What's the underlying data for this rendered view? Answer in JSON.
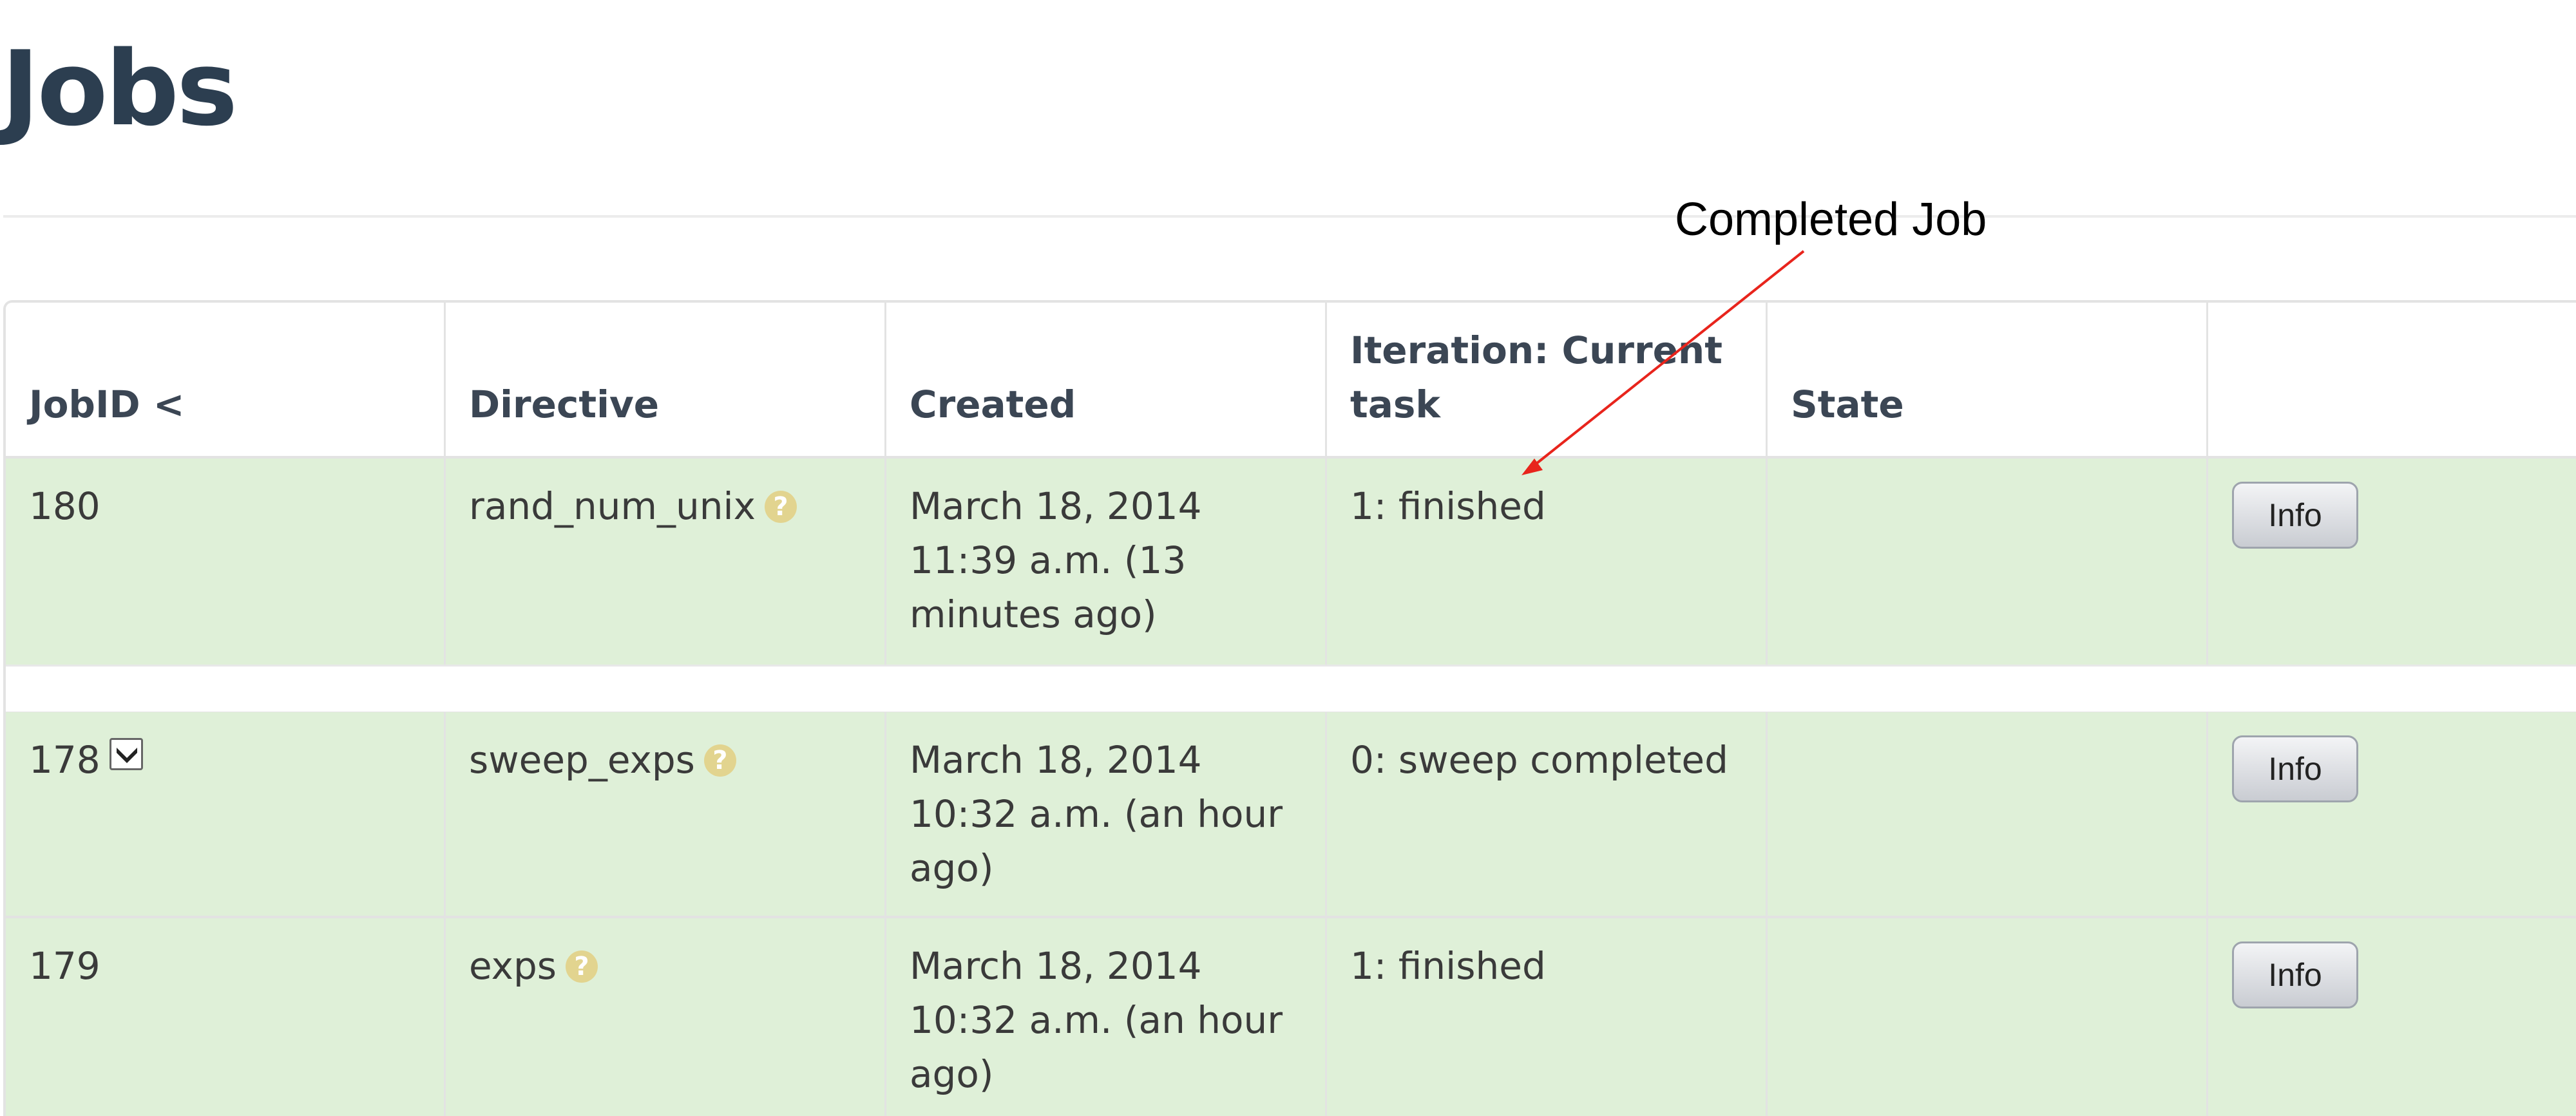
{
  "page": {
    "title": "Jobs"
  },
  "annotation": {
    "text": "Completed Job"
  },
  "table": {
    "headers": [
      "JobID <",
      "Directive",
      "Created",
      "Iteration: Current task",
      "State",
      ""
    ],
    "rows": [
      {
        "job_id": "180",
        "directive": "rand_num_unix",
        "created": "March 18, 2014 11:39 a.m. (13 minutes ago)",
        "iteration": "1: finished",
        "state": "",
        "action": "Info"
      },
      {
        "job_id": "178",
        "directive": "sweep_exps",
        "created": "March 18, 2014 10:32 a.m. (an hour ago)",
        "iteration": "0: sweep completed",
        "state": "",
        "action": "Info"
      },
      {
        "job_id": "179",
        "directive": "exps",
        "created": "March 18, 2014 10:32 a.m. (an hour ago)",
        "iteration": "1: finished",
        "state": "",
        "action": "Info"
      }
    ]
  },
  "icons": {
    "help": "help-icon",
    "expand": "chevron-down-icon"
  },
  "colors": {
    "row_success": "#dff0d8",
    "title": "#2c3e50",
    "help_icon": "#e2d48f",
    "annotation_arrow": "#e8241c"
  }
}
